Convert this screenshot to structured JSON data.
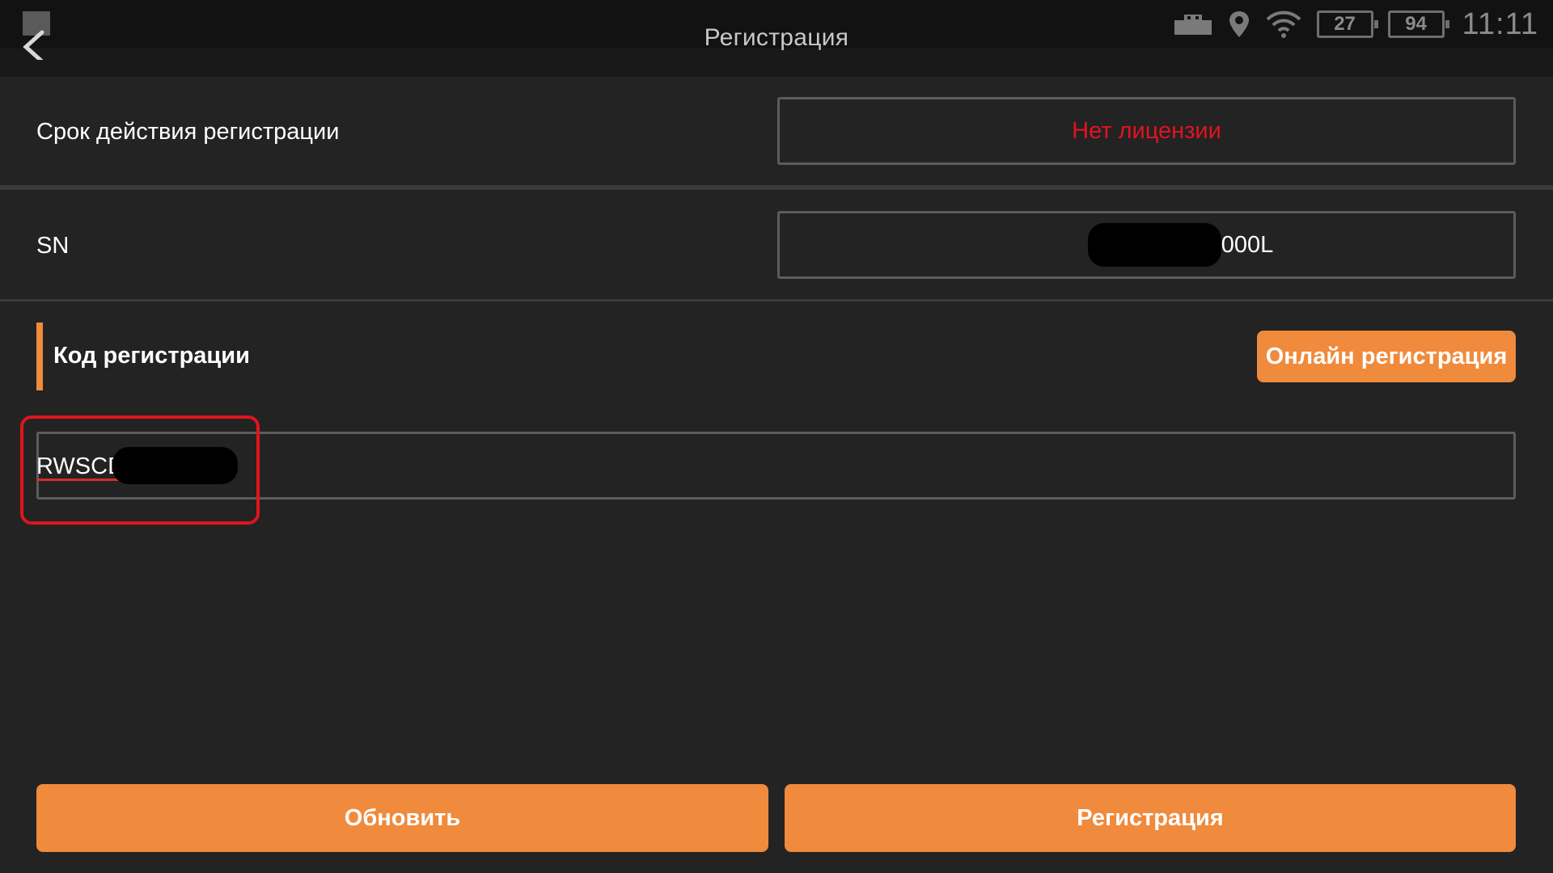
{
  "header": {
    "title": "Регистрация",
    "back_icon": "chevron-left-icon"
  },
  "status_bar": {
    "icons": [
      "usb-icon",
      "location-pin-icon",
      "wifi-icon"
    ],
    "battery_left": "27",
    "battery_right": "94",
    "time": "11:11"
  },
  "rows": {
    "validity": {
      "label": "Срок действия регистрации",
      "value": "Нет лицензии",
      "value_color": "#e0141e"
    },
    "sn": {
      "label": "SN",
      "value_suffix": "000L"
    }
  },
  "registration_code": {
    "section_title": "Код регистрации",
    "online_button": "Онлайн регистрация",
    "value_visible": "RWSCD"
  },
  "footer": {
    "refresh_button": "Обновить",
    "register_button": "Регистрация"
  },
  "colors": {
    "accent": "#f08a3c",
    "background": "#232323",
    "error": "#e0141e"
  }
}
